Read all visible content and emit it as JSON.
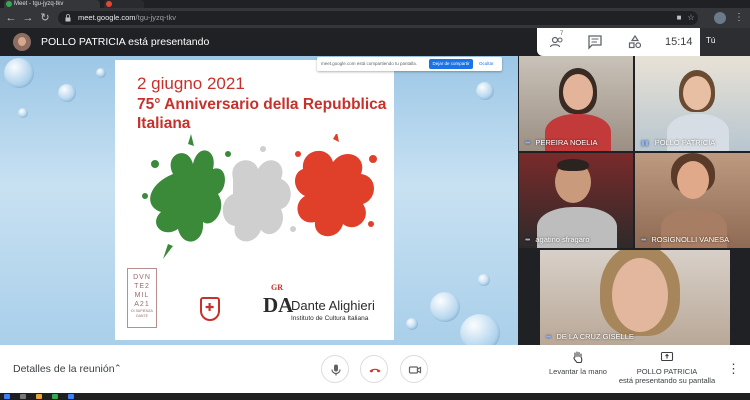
{
  "browser": {
    "tabs": [
      {
        "title": "Meet - tgu-jyzq-tkv"
      },
      {
        "title": ""
      }
    ],
    "url": {
      "host": "meet.google.com",
      "path": "/tgu-jyzq-tkv"
    }
  },
  "meet": {
    "presenter_text": "POLLO PATRICIA está presentando",
    "participants_count": "7",
    "clock": "15:14",
    "self_label": "Tú"
  },
  "share_notice": {
    "text": "meet.google.com está compartiendo tu pantalla.",
    "stop_label": "Dejar de compartir",
    "hide_label": "Ocultar"
  },
  "slide": {
    "date": "2 giugno 2021",
    "title": "75° Anniversario della Repubblica Italiana",
    "logo_left_text": "DVN TE2 MIL A21",
    "logo_left_sub": "DI SAPIENZA DANTE",
    "logo_mark_small": "GR",
    "logo_mark": "DA",
    "org_name": "Dante Alighieri",
    "org_sub": "Instituto de Cultura Italiana",
    "flag_colors": {
      "green": "#3a8a3a",
      "white": "#d9d9d9",
      "red": "#e0402a"
    }
  },
  "participants": [
    {
      "name": "PEREIRA NOELIA",
      "speaking": false
    },
    {
      "name": "POLLO PATRICIA",
      "speaking": true
    },
    {
      "name": "agatino sfragaro",
      "speaking": false
    },
    {
      "name": "ROSIGNOLLI VANESA",
      "speaking": false
    },
    {
      "name": "DE LA CRUZ GISELLE",
      "speaking": false
    }
  ],
  "bottom_bar": {
    "details_label": "Detalles de la reunión",
    "raise_hand_label": "Levantar la mano",
    "presenting_name": "POLLO PATRICIA",
    "presenting_sub": "está presentando su pantalla"
  },
  "icons": {
    "back": "arrow-left-icon",
    "forward": "arrow-right-icon",
    "reload": "reload-icon",
    "lock": "lock-icon",
    "camera_blocked": "camera-icon",
    "star": "star-icon",
    "people": "people-icon",
    "chat": "chat-icon",
    "activities": "shapes-icon",
    "mic": "mic-icon",
    "hangup": "phone-hangup-icon",
    "video": "video-icon",
    "hand": "hand-icon",
    "present": "present-icon",
    "more": "more-vert-icon"
  },
  "colors": {
    "accent": "#1a73e8",
    "hangup": "#d93025",
    "meet_dark": "#202124"
  }
}
